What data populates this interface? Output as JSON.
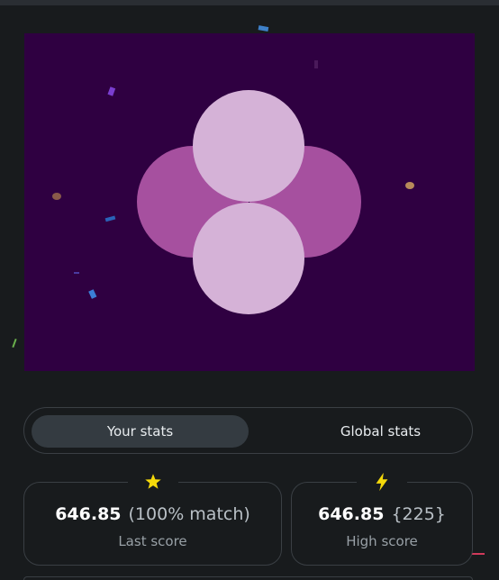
{
  "game": {
    "colors": {
      "background": "#2f0041",
      "outer_circles": "#a6509f",
      "inner_circles": "#d5b2d7"
    }
  },
  "stats_toggle": {
    "your_stats_label": "Your stats",
    "global_stats_label": "Global stats",
    "active": "Your stats"
  },
  "last_score_card": {
    "icon": "star-icon",
    "value": "646.85",
    "extra": "(100% match)",
    "label": "Last score"
  },
  "high_score_card": {
    "icon": "lightning-icon",
    "value": "646.85",
    "extra": "{225}",
    "label": "High score"
  }
}
